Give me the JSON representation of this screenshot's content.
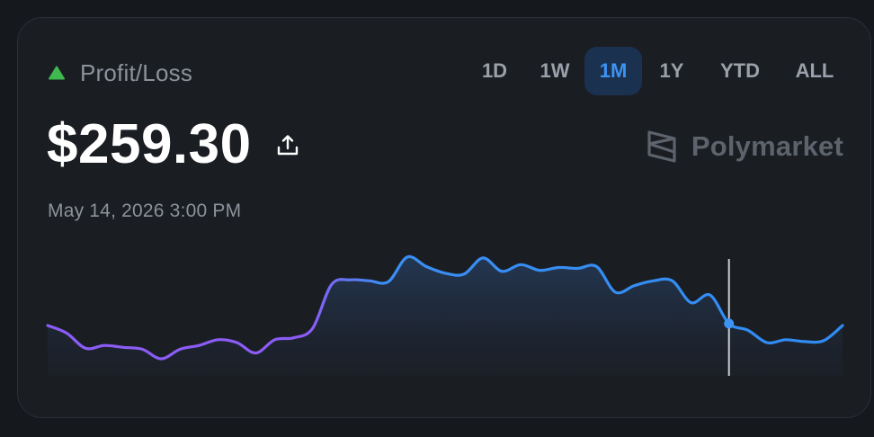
{
  "header": {
    "label": "Profit/Loss",
    "trend_icon": "triangle-up-icon",
    "trend_color": "#3fb950"
  },
  "range_tabs": [
    {
      "label": "1D",
      "active": false
    },
    {
      "label": "1W",
      "active": false
    },
    {
      "label": "1M",
      "active": true
    },
    {
      "label": "1Y",
      "active": false
    },
    {
      "label": "YTD",
      "active": false
    },
    {
      "label": "ALL",
      "active": false
    }
  ],
  "value": {
    "amount": "$259.30",
    "share_icon": "share-upload-icon"
  },
  "brand": {
    "name": "Polymarket",
    "logo_icon": "polymarket-logo-icon"
  },
  "timestamp": "May 14, 2026 3:00 PM",
  "colors": {
    "accent": "#3b93f3",
    "line_start": "#8b5cf6",
    "line_end": "#2f8cf4"
  },
  "chart_data": {
    "type": "area",
    "title": "",
    "xlabel": "",
    "ylabel": "",
    "grid": false,
    "legend": "none",
    "x": [
      0,
      1,
      2,
      3,
      4,
      5,
      6,
      7,
      8,
      9,
      10,
      11,
      12,
      13,
      14,
      15,
      16,
      17,
      18,
      19,
      20,
      21,
      22,
      23,
      24,
      25,
      26,
      27,
      28,
      29,
      30,
      31,
      32,
      33,
      34,
      35,
      36,
      37,
      38,
      39,
      40,
      41,
      42,
      43,
      44,
      45,
      46,
      47,
      48,
      49,
      50,
      51,
      52,
      53,
      54,
      55,
      56,
      57,
      58,
      59,
      60
    ],
    "values": [
      143,
      135,
      119,
      122,
      120,
      118,
      108,
      118,
      122,
      128,
      125,
      114,
      128,
      130,
      140,
      186,
      191,
      190,
      189,
      215,
      205,
      198,
      197,
      214,
      200,
      207,
      201,
      204,
      203,
      205,
      178,
      185,
      190,
      190,
      167,
      175,
      145,
      138,
      125,
      128,
      126,
      127,
      143
    ],
    "selected_index": 36,
    "ylim": [
      90,
      230
    ]
  }
}
